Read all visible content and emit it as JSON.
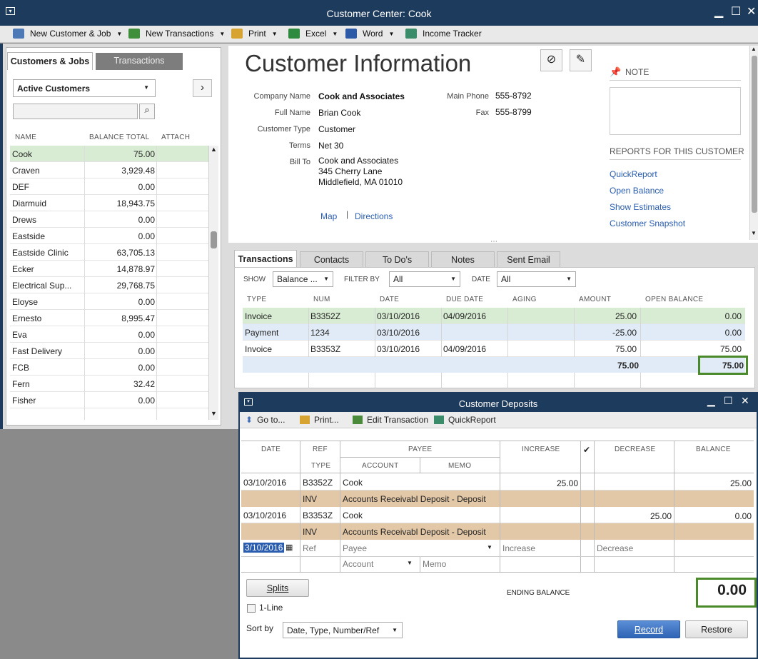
{
  "window": {
    "title": "Customer Center: Cook"
  },
  "toolbar": [
    {
      "label": "New Customer & Job",
      "icon": "new-customer-icon"
    },
    {
      "label": "New Transactions",
      "icon": "new-transactions-icon"
    },
    {
      "label": "Print",
      "icon": "print-icon"
    },
    {
      "label": "Excel",
      "icon": "excel-icon"
    },
    {
      "label": "Word",
      "icon": "word-icon"
    },
    {
      "label": "Income Tracker",
      "icon": "income-tracker-icon"
    }
  ],
  "left": {
    "tabs": [
      "Customers & Jobs",
      "Transactions"
    ],
    "filter": "Active Customers",
    "search_placeholder": "",
    "columns": [
      "NAME",
      "BALANCE TOTAL",
      "ATTACH"
    ],
    "customers": [
      {
        "name": "Cook",
        "balance": "75.00"
      },
      {
        "name": "Craven",
        "balance": "3,929.48"
      },
      {
        "name": "DEF",
        "balance": "0.00"
      },
      {
        "name": "Diarmuid",
        "balance": "18,943.75"
      },
      {
        "name": "Drews",
        "balance": "0.00"
      },
      {
        "name": "Eastside",
        "balance": "0.00"
      },
      {
        "name": "Eastside Clinic",
        "balance": "63,705.13"
      },
      {
        "name": "Ecker",
        "balance": "14,878.97"
      },
      {
        "name": "Electrical Sup...",
        "balance": "29,768.75"
      },
      {
        "name": "Eloyse",
        "balance": "0.00"
      },
      {
        "name": "Ernesto",
        "balance": "8,995.47"
      },
      {
        "name": "Eva",
        "balance": "0.00"
      },
      {
        "name": "Fast Delivery",
        "balance": "0.00"
      },
      {
        "name": "FCB",
        "balance": "0.00"
      },
      {
        "name": "Fern",
        "balance": "32.42"
      },
      {
        "name": "Fisher",
        "balance": "0.00"
      }
    ]
  },
  "info": {
    "heading": "Customer Information",
    "fields": [
      {
        "label": "Company Name",
        "value": "Cook and Associates"
      },
      {
        "label": "Full Name",
        "value": "Brian  Cook"
      },
      {
        "label": "Customer Type",
        "value": "Customer"
      },
      {
        "label": "Terms",
        "value": "Net 30"
      },
      {
        "label": "Bill To",
        "value": "Cook and Associates"
      }
    ],
    "bill_to_lines": [
      "345 Cherry Lane",
      "Middlefield, MA 01010"
    ],
    "phone": {
      "label": "Main Phone",
      "value": "555-8792"
    },
    "fax": {
      "label": "Fax",
      "value": "555-8799"
    },
    "map": "Map",
    "directions": "Directions",
    "note_label": "NOTE",
    "reports_heading": "REPORTS FOR THIS CUSTOMER",
    "reports": [
      "QuickReport",
      "Open Balance",
      "Show Estimates",
      "Customer Snapshot"
    ]
  },
  "tx": {
    "tabs": [
      "Transactions",
      "Contacts",
      "To Do's",
      "Notes",
      "Sent Email"
    ],
    "show_label": "SHOW",
    "show_value": "Balance ...",
    "filter_label": "FILTER BY",
    "filter_value": "All",
    "date_label": "DATE",
    "date_value": "All",
    "columns": [
      "TYPE",
      "NUM",
      "DATE",
      "DUE DATE",
      "AGING",
      "AMOUNT",
      "OPEN BALANCE"
    ],
    "rows": [
      {
        "type": "Invoice",
        "num": "B3352Z",
        "date": "03/10/2016",
        "due": "04/09/2016",
        "aging": "",
        "amount": "25.00",
        "open": "0.00"
      },
      {
        "type": "Payment",
        "num": "1234",
        "date": "03/10/2016",
        "due": "",
        "aging": "",
        "amount": "-25.00",
        "open": "0.00"
      },
      {
        "type": "Invoice",
        "num": "B3353Z",
        "date": "03/10/2016",
        "due": "04/09/2016",
        "aging": "",
        "amount": "75.00",
        "open": "75.00"
      }
    ],
    "total_amount": "75.00",
    "total_open": "75.00"
  },
  "deposits": {
    "title": "Customer Deposits",
    "toolbar": [
      "Go to...",
      "Print...",
      "Edit Transaction",
      "QuickReport"
    ],
    "cols": {
      "date": "DATE",
      "ref": "REF",
      "type": "TYPE",
      "payee": "PAYEE",
      "account": "ACCOUNT",
      "memo": "MEMO",
      "increase": "INCREASE",
      "check": "✔",
      "decrease": "DECREASE",
      "balance": "BALANCE"
    },
    "rows": [
      {
        "date": "03/10/2016",
        "ref": "B3352Z",
        "payee": "Cook",
        "increase": "25.00",
        "decrease": "",
        "balance": "25.00",
        "type": "INV",
        "account": "Accounts Receivabl Deposit - Deposit"
      },
      {
        "date": "03/10/2016",
        "ref": "B3353Z",
        "payee": "Cook",
        "increase": "",
        "decrease": "25.00",
        "balance": "0.00",
        "type": "INV",
        "account": "Accounts Receivabl Deposit - Deposit"
      }
    ],
    "entry": {
      "date": "3/10/2016",
      "ref": "Ref",
      "payee": "Payee",
      "increase": "Increase",
      "decrease": "Decrease",
      "account": "Account",
      "memo": "Memo"
    },
    "splits": "Splits",
    "one_line": "1-Line",
    "ending_label": "ENDING BALANCE",
    "ending_value": "0.00",
    "sort_label": "Sort by",
    "sort_value": "Date, Type, Number/Ref",
    "record": "Record",
    "restore": "Restore"
  }
}
